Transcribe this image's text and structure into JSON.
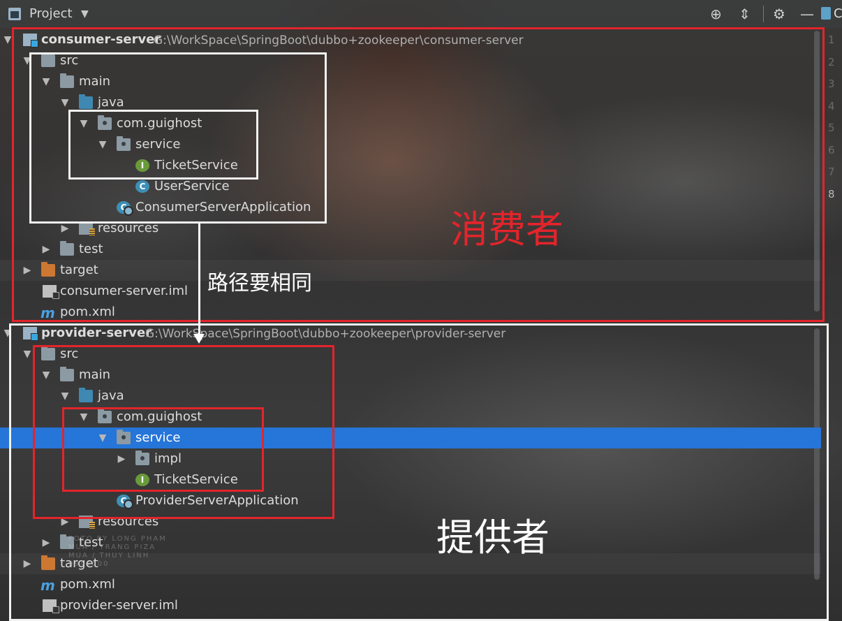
{
  "toolbar": {
    "title": "Project",
    "icons": [
      "target-icon",
      "collapse-icon",
      "gear-icon",
      "minimize-icon"
    ],
    "right_tab": "C"
  },
  "tree": {
    "consumer": {
      "module_name": "consumer-server",
      "module_path": "G:\\WorkSpace\\SpringBoot\\dubbo+zookeeper\\consumer-server",
      "src": "src",
      "main": "main",
      "java": "java",
      "package": "com.guighost",
      "service": "service",
      "ticket_service": "TicketService",
      "user_service": "UserService",
      "application": "ConsumerServerApplication",
      "resources": "resources",
      "test": "test",
      "target": "target",
      "iml": "consumer-server.iml",
      "pom": "pom.xml"
    },
    "provider": {
      "module_name": "provider-server",
      "module_path": "G:\\WorkSpace\\SpringBoot\\dubbo+zookeeper\\provider-server",
      "src": "src",
      "main": "main",
      "java": "java",
      "package": "com.guighost",
      "service": "service",
      "impl": "impl",
      "ticket_service": "TicketService",
      "application": "ProviderServerApplication",
      "resources": "resources",
      "test": "test",
      "target": "target",
      "pom": "pom.xml",
      "iml": "provider-server.iml"
    }
  },
  "gutter": {
    "line_numbers": [
      "1",
      "2",
      "3",
      "4",
      "5",
      "6",
      "7",
      "8"
    ]
  },
  "annotations": {
    "consumer_label": "消费者",
    "provider_label": "提供者",
    "path_note": "路径要相同"
  },
  "watermark": {
    "line1": "FOTO BY LONG PHAM",
    "line2": "MUA / TRANG PIZA",
    "line3": "MUA / THUY LINH",
    "line4": "0944000"
  },
  "colors": {
    "selection": "#2675d8",
    "annotation_red": "#e4242b",
    "annotation_white": "#f2f2f2"
  }
}
